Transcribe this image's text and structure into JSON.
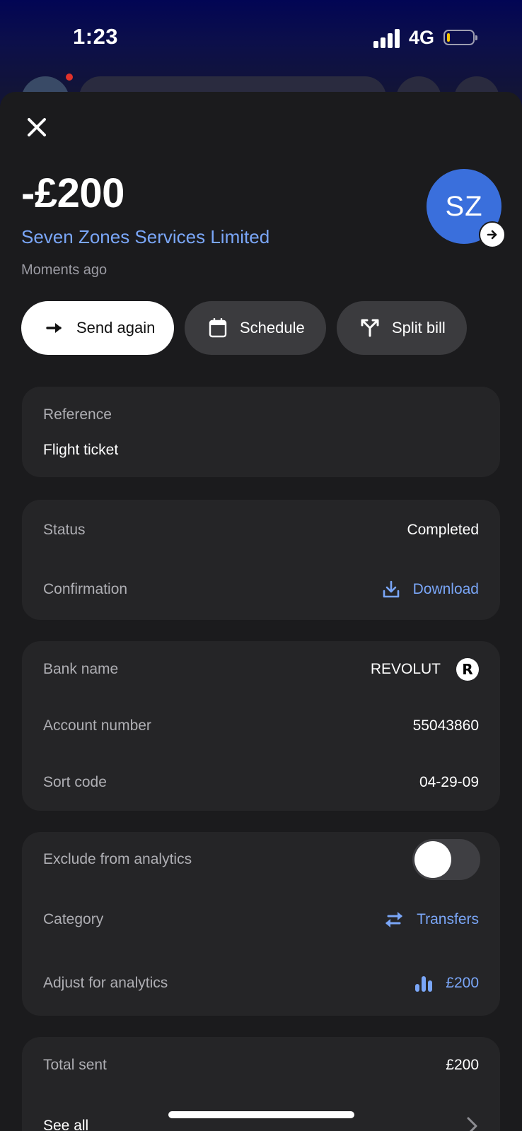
{
  "status_bar": {
    "time": "1:23",
    "network": "4G",
    "battery_level": 0.1,
    "battery_color": "#f5c400"
  },
  "transaction": {
    "amount": "-£200",
    "merchant": "Seven Zones Services Limited",
    "time": "Moments ago",
    "avatar_initials": "SZ",
    "avatar_color": "#3a6fdc"
  },
  "actions": {
    "send_again": "Send again",
    "schedule": "Schedule",
    "split_bill": "Split bill"
  },
  "reference": {
    "label": "Reference",
    "value": "Flight ticket"
  },
  "status_card": {
    "status_label": "Status",
    "status_value": "Completed",
    "confirmation_label": "Confirmation",
    "download_label": "Download"
  },
  "bank_card": {
    "bank_name_label": "Bank name",
    "bank_name_value": "REVOLUT",
    "account_number_label": "Account number",
    "account_number_value": "55043860",
    "sort_code_label": "Sort code",
    "sort_code_value": "04-29-09"
  },
  "analytics_card": {
    "exclude_label": "Exclude from analytics",
    "exclude_enabled": false,
    "category_label": "Category",
    "category_value": "Transfers",
    "adjust_label": "Adjust for analytics",
    "adjust_value": "£200"
  },
  "summary_card": {
    "total_sent_label": "Total sent",
    "total_sent_value": "£200",
    "see_all_label": "See all"
  },
  "colors": {
    "accent": "#7aa6f7",
    "sheet": "#1b1b1d",
    "card": "#252527"
  }
}
